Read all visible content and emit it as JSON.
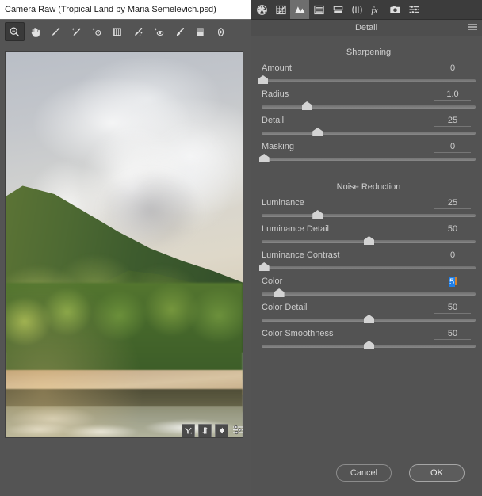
{
  "window": {
    "title": "Camera Raw (Tropical Land by Maria Semelevich.psd)"
  },
  "toolbar": {
    "tools": [
      {
        "name": "zoom-tool",
        "label": "Zoom",
        "active": true
      },
      {
        "name": "hand-tool",
        "label": "Hand",
        "active": false
      },
      {
        "name": "white-balance-tool",
        "label": "White Balance",
        "active": false
      },
      {
        "name": "color-sampler-tool",
        "label": "Color Sampler",
        "active": false
      },
      {
        "name": "targeted-adjustment-tool",
        "label": "Targeted Adjustment",
        "active": false
      },
      {
        "name": "crop-tool",
        "label": "Crop",
        "active": false
      },
      {
        "name": "spot-removal-tool",
        "label": "Spot Removal",
        "active": false
      },
      {
        "name": "red-eye-tool",
        "label": "Red Eye Removal",
        "active": false
      },
      {
        "name": "adjustment-brush-tool",
        "label": "Adjustment Brush",
        "active": false
      },
      {
        "name": "graduated-filter-tool",
        "label": "Graduated Filter",
        "active": false
      },
      {
        "name": "radial-filter-tool",
        "label": "Radial Filter",
        "active": false
      }
    ]
  },
  "preview": {
    "buttons": [
      {
        "name": "before-after-button",
        "label": "Y"
      },
      {
        "name": "swap-before-after-button",
        "label": "swap-icon"
      },
      {
        "name": "copy-settings-button",
        "label": "arrow-left-icon"
      },
      {
        "name": "preview-preferences-button",
        "label": "sliders-icon"
      }
    ]
  },
  "panel": {
    "title": "Detail",
    "menu_icon": "hamburger-menu-icon",
    "tabs": [
      {
        "name": "tab-basic",
        "icon": "aperture-icon",
        "active": false
      },
      {
        "name": "tab-tone-curve",
        "icon": "tone-curve-icon",
        "active": false
      },
      {
        "name": "tab-detail",
        "icon": "detail-triangles-icon",
        "active": true
      },
      {
        "name": "tab-hsl-grayscale",
        "icon": "hsl-bars-icon",
        "active": false
      },
      {
        "name": "tab-split-toning",
        "icon": "split-toning-icon",
        "active": false
      },
      {
        "name": "tab-lens-corrections",
        "icon": "lens-icon",
        "active": false
      },
      {
        "name": "tab-effects",
        "icon": "fx-icon",
        "active": false
      },
      {
        "name": "tab-camera-calibration",
        "icon": "camera-icon",
        "active": false
      },
      {
        "name": "tab-presets",
        "icon": "sliders-icon",
        "active": false
      }
    ],
    "sections": [
      {
        "name": "sharpening",
        "title": "Sharpening",
        "sliders": [
          {
            "name": "amount",
            "label": "Amount",
            "value": "0",
            "pos": 0,
            "editing": false
          },
          {
            "name": "radius",
            "label": "Radius",
            "value": "1.0",
            "pos": 21,
            "editing": false
          },
          {
            "name": "detail",
            "label": "Detail",
            "value": "25",
            "pos": 26,
            "editing": false
          },
          {
            "name": "masking",
            "label": "Masking",
            "value": "0",
            "pos": 1,
            "editing": false
          }
        ]
      },
      {
        "name": "noise-reduction",
        "title": "Noise Reduction",
        "sliders": [
          {
            "name": "luminance",
            "label": "Luminance",
            "value": "25",
            "pos": 25,
            "editing": false
          },
          {
            "name": "luminance-detail",
            "label": "Luminance Detail",
            "value": "50",
            "pos": 50,
            "editing": false
          },
          {
            "name": "luminance-contrast",
            "label": "Luminance Contrast",
            "value": "0",
            "pos": 1,
            "editing": false
          },
          {
            "name": "color",
            "label": "Color",
            "value": "5",
            "pos": 8,
            "editing": true
          },
          {
            "name": "color-detail",
            "label": "Color Detail",
            "value": "50",
            "pos": 50,
            "editing": false
          },
          {
            "name": "color-smoothness",
            "label": "Color Smoothness",
            "value": "50",
            "pos": 50,
            "editing": false
          }
        ]
      }
    ]
  },
  "footer": {
    "cancel_label": "Cancel",
    "ok_label": "OK"
  },
  "colors": {
    "accent_selection": "#1f7fe8",
    "caret": "#d4822a",
    "panel_bg": "#535353",
    "tabbar_bg": "#3c3c3c"
  }
}
